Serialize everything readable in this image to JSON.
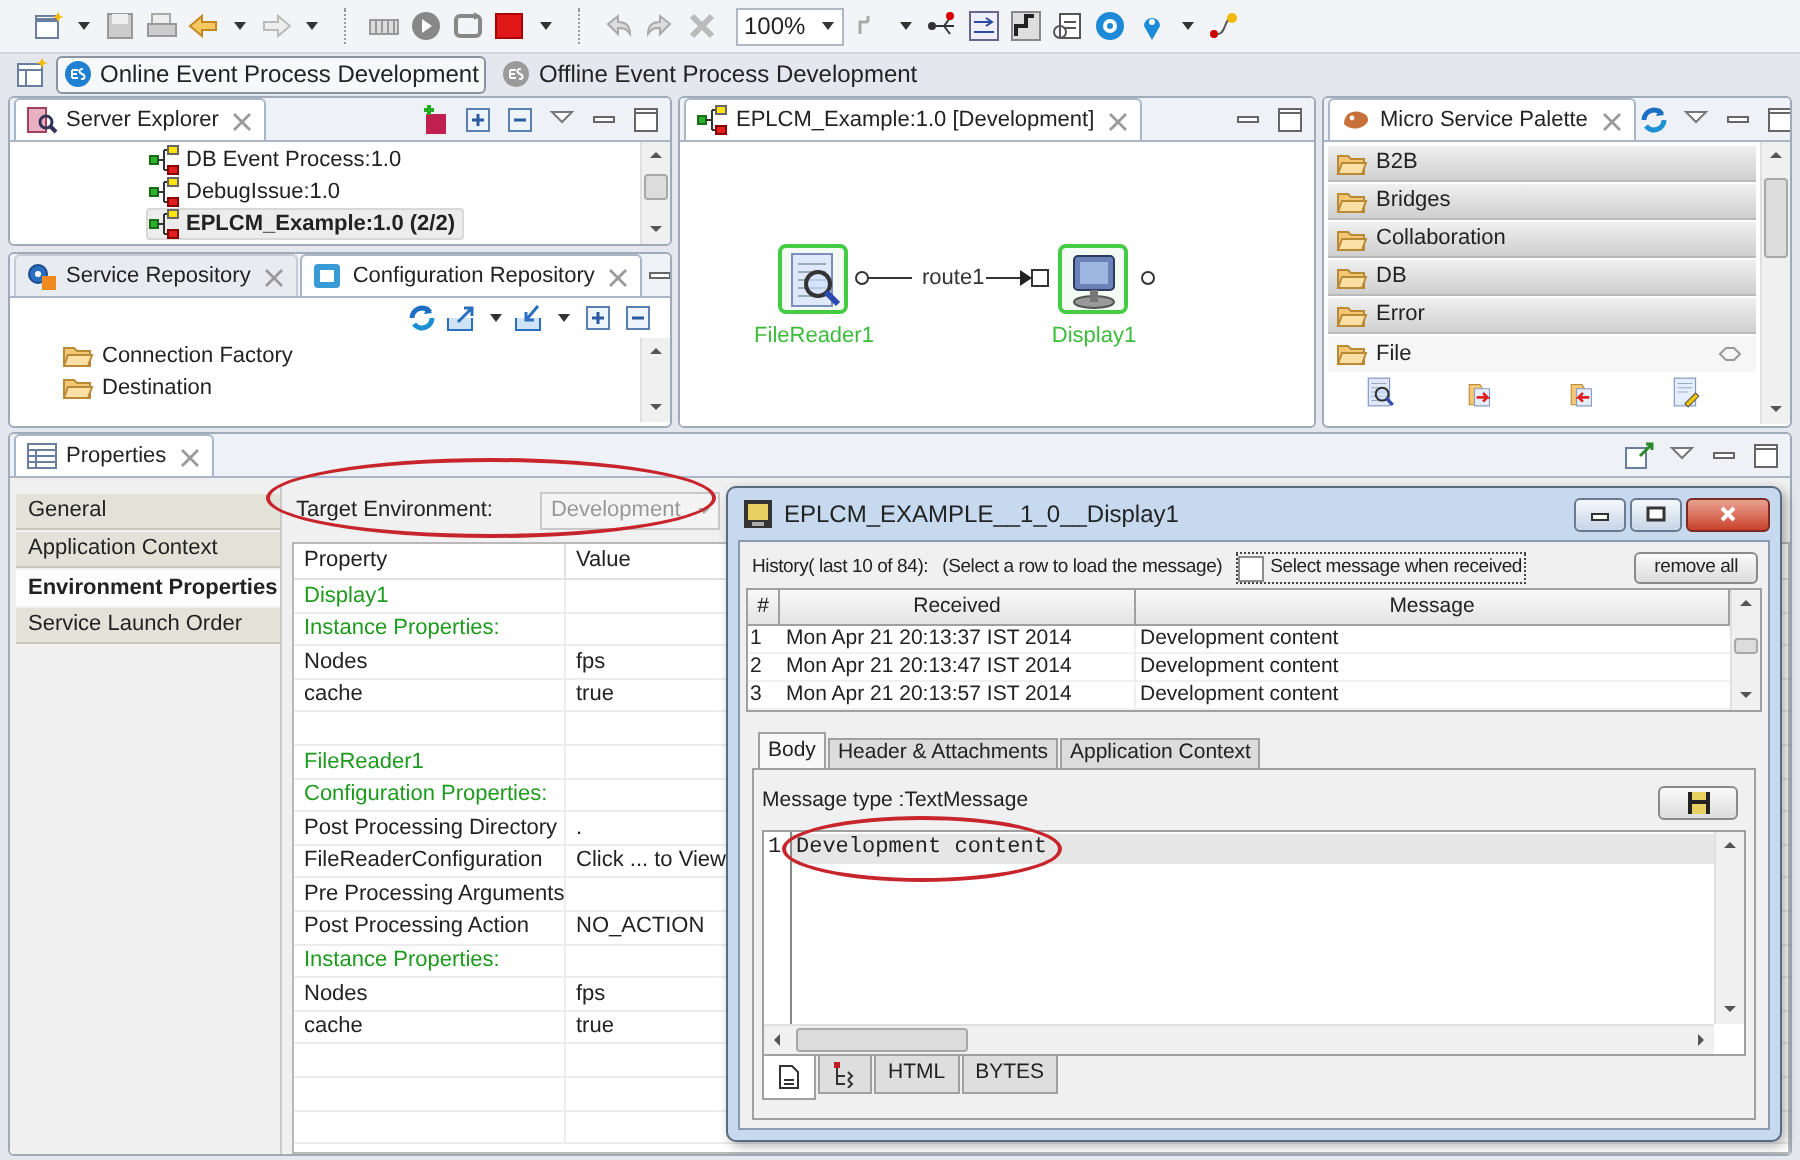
{
  "toolbar": {
    "zoom": "100%"
  },
  "perspectives": [
    {
      "label": "Online Event Process Development",
      "selected": true
    },
    {
      "label": "Offline Event Process Development",
      "selected": false
    }
  ],
  "server_explorer": {
    "title": "Server Explorer",
    "items": [
      {
        "label": "DB Event Process:1.0",
        "selected": false
      },
      {
        "label": "DebugIssue:1.0",
        "selected": false
      },
      {
        "label": "EPLCM_Example:1.0 (2/2)",
        "selected": true
      }
    ]
  },
  "repository": {
    "tabs": [
      {
        "label": "Service Repository",
        "selected": false
      },
      {
        "label": "Configuration Repository",
        "selected": true
      }
    ],
    "items": [
      "Connection Factory",
      "Destination"
    ]
  },
  "editor": {
    "title": "EPLCM_Example:1.0 [Development]",
    "route": "route1",
    "nodes": [
      {
        "label": "FileReader1",
        "kind": "reader"
      },
      {
        "label": "Display1",
        "kind": "display"
      }
    ]
  },
  "palette": {
    "title": "Micro Service Palette",
    "drawers": [
      {
        "label": "B2B",
        "expanded": false
      },
      {
        "label": "Bridges",
        "expanded": false
      },
      {
        "label": "Collaboration",
        "expanded": false
      },
      {
        "label": "DB",
        "expanded": false
      },
      {
        "label": "Error",
        "expanded": false
      },
      {
        "label": "File",
        "expanded": true
      }
    ]
  },
  "properties": {
    "title": "Properties",
    "nav": [
      {
        "label": "General",
        "selected": false
      },
      {
        "label": "Application Context",
        "selected": false
      },
      {
        "label": "Environment Properties",
        "selected": true
      },
      {
        "label": "Service Launch Order",
        "selected": false
      }
    ],
    "target_label": "Target Environment:",
    "target": {
      "value": "Development",
      "disabled": true
    },
    "columns": [
      "Property",
      "Value"
    ],
    "rows": [
      {
        "kind": "heading",
        "property": "Display1"
      },
      {
        "kind": "heading",
        "property": "Instance Properties:"
      },
      {
        "kind": "property",
        "property": "Nodes",
        "value": "fps"
      },
      {
        "kind": "property",
        "property": "cache",
        "value": "true"
      },
      {
        "kind": "spacer"
      },
      {
        "kind": "heading",
        "property": "FileReader1"
      },
      {
        "kind": "heading",
        "property": "Configuration Properties:"
      },
      {
        "kind": "property",
        "property": "Post Processing Directory",
        "value": "."
      },
      {
        "kind": "property",
        "property": "FileReaderConfiguration",
        "value": "Click ... to View"
      },
      {
        "kind": "property",
        "property": "Pre Processing Arguments"
      },
      {
        "kind": "property",
        "property": "Post Processing Action",
        "value": "NO_ACTION"
      },
      {
        "kind": "heading",
        "property": "Instance Properties:"
      },
      {
        "kind": "property",
        "property": "Nodes",
        "value": "fps"
      },
      {
        "kind": "property",
        "property": "cache",
        "value": "true"
      }
    ]
  },
  "message_window": {
    "title": "EPLCM_EXAMPLE__1_0__Display1",
    "history_label": "History( last 10 of 84):",
    "hint": "(Select a row to load the message)",
    "checkbox": {
      "label": "Select message when received",
      "checked": false
    },
    "button": "remove all",
    "columns": [
      "#",
      "Received",
      "Message"
    ],
    "rows": [
      {
        "number": "1",
        "received": "Mon Apr 21 20:13:37 IST 2014",
        "message": "Development content"
      },
      {
        "number": "2",
        "received": "Mon Apr 21 20:13:47 IST 2014",
        "message": "Development content"
      },
      {
        "number": "3",
        "received": "Mon Apr 21 20:13:57 IST 2014",
        "message": "Development content"
      }
    ],
    "tabs": [
      {
        "label": "Body",
        "selected": true
      },
      {
        "label": "Header & Attachments",
        "selected": false
      },
      {
        "label": "Application Context",
        "selected": false
      }
    ],
    "message_type": "Message type :TextMessage",
    "lines": [
      {
        "number": "1",
        "text": "Development content"
      }
    ],
    "view_tabs": [
      {
        "kind": "text",
        "selected": true
      },
      {
        "kind": "tree",
        "selected": false
      },
      {
        "kind": "label",
        "label": "HTML",
        "selected": false
      },
      {
        "kind": "label",
        "label": "BYTES",
        "selected": false
      }
    ]
  }
}
